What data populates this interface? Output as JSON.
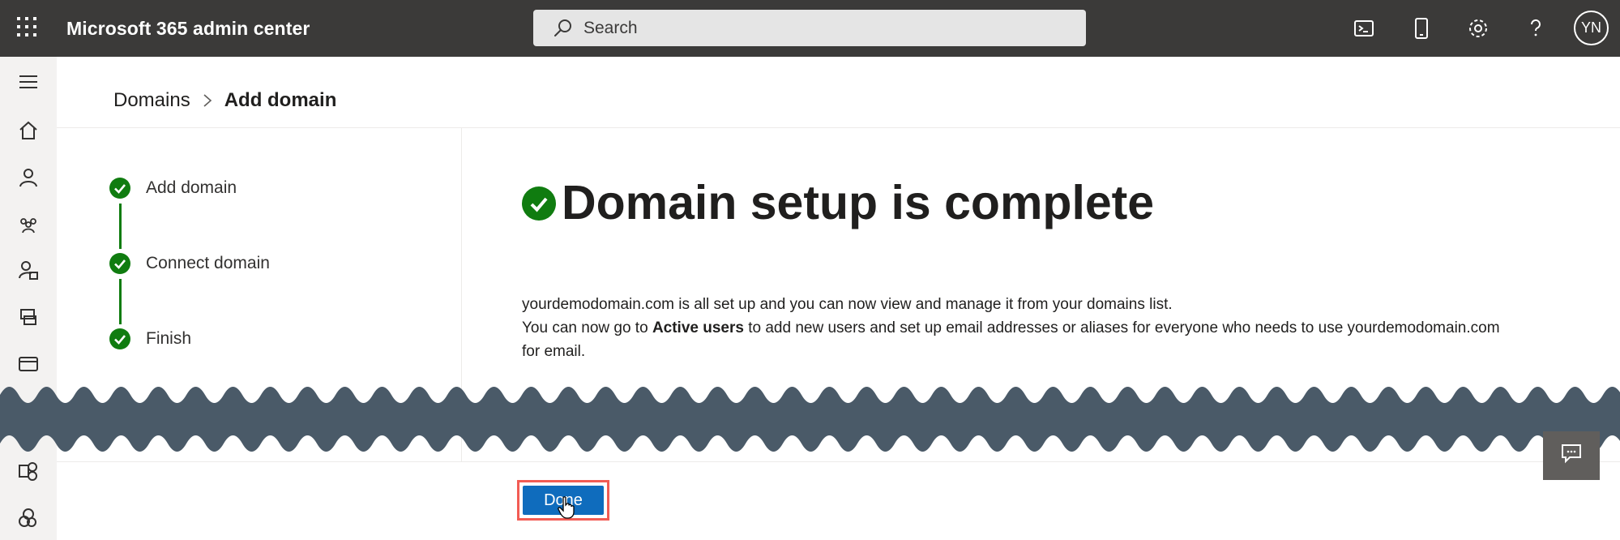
{
  "header": {
    "app_title": "Microsoft 365 admin center",
    "search_placeholder": "Search",
    "avatar_initials": "YN",
    "icons": [
      "waffle-icon",
      "terminal-icon",
      "mobile-icon",
      "gear-icon",
      "help-icon"
    ]
  },
  "leftnav": {
    "icons": [
      "menu-icon",
      "home-icon",
      "user-icon",
      "group-icon",
      "roles-icon",
      "devices-icon",
      "billing-icon",
      "exchange-icon",
      "sharepoint-icon"
    ]
  },
  "breadcrumb": {
    "parent": "Domains",
    "current": "Add domain"
  },
  "steps": [
    {
      "label": "Add domain",
      "status": "complete"
    },
    {
      "label": "Connect domain",
      "status": "complete"
    },
    {
      "label": "Finish",
      "status": "complete"
    }
  ],
  "main": {
    "title": "Domain setup is complete",
    "line1": "yourdemodomain.com is all set up and you can now view and manage it from your domains list.",
    "line2_pre": "You can now go to ",
    "line2_bold": "Active users",
    "line2_post": " to add new users and set up email addresses or aliases for everyone who needs to use yourdemodomain.com",
    "line3": "for email."
  },
  "footer": {
    "done_label": "Done"
  },
  "colors": {
    "topbar": "#3b3a39",
    "success": "#107c10",
    "primary": "#0f6cbd",
    "highlight": "#f25c54",
    "wave": "#4a5a68"
  }
}
